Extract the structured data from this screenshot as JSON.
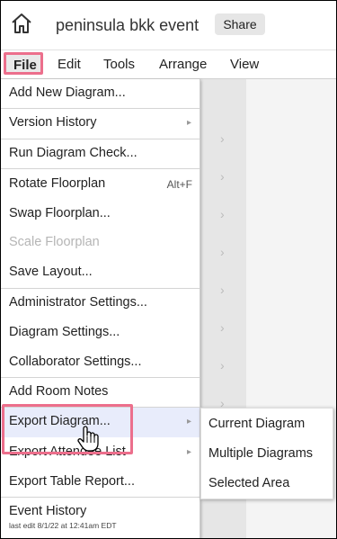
{
  "header": {
    "title": "peninsula bkk event",
    "share_label": "Share",
    "home_icon": "home-icon"
  },
  "menubar": {
    "items": [
      "File",
      "Edit",
      "Tools",
      "Arrange",
      "View"
    ]
  },
  "file_menu": {
    "items": [
      {
        "label": "Add New Diagram..."
      },
      {
        "label": "Version History",
        "submenu": true
      },
      {
        "label": "Run Diagram Check..."
      },
      {
        "label": "Rotate Floorplan",
        "shortcut": "Alt+F"
      },
      {
        "label": "Swap Floorplan..."
      },
      {
        "label": "Scale Floorplan",
        "disabled": true
      },
      {
        "label": "Save Layout..."
      },
      {
        "label": "Administrator Settings..."
      },
      {
        "label": "Diagram Settings..."
      },
      {
        "label": "Collaborator Settings..."
      },
      {
        "label": "Add Room Notes"
      },
      {
        "label": "Export Diagram...",
        "submenu": true,
        "highlighted": true
      },
      {
        "label": "Export Attendee List",
        "submenu": true
      },
      {
        "label": "Export Table Report..."
      },
      {
        "label": "Event History",
        "meta": "last edit 8/1/22 at 12:41am EDT"
      }
    ]
  },
  "export_submenu": {
    "items": [
      "Current Diagram",
      "Multiple Diagrams",
      "Selected Area"
    ]
  },
  "colors": {
    "callout": "#ec6f8c",
    "highlight": "#e8ecfb",
    "share_bg": "#e6e6e6"
  }
}
